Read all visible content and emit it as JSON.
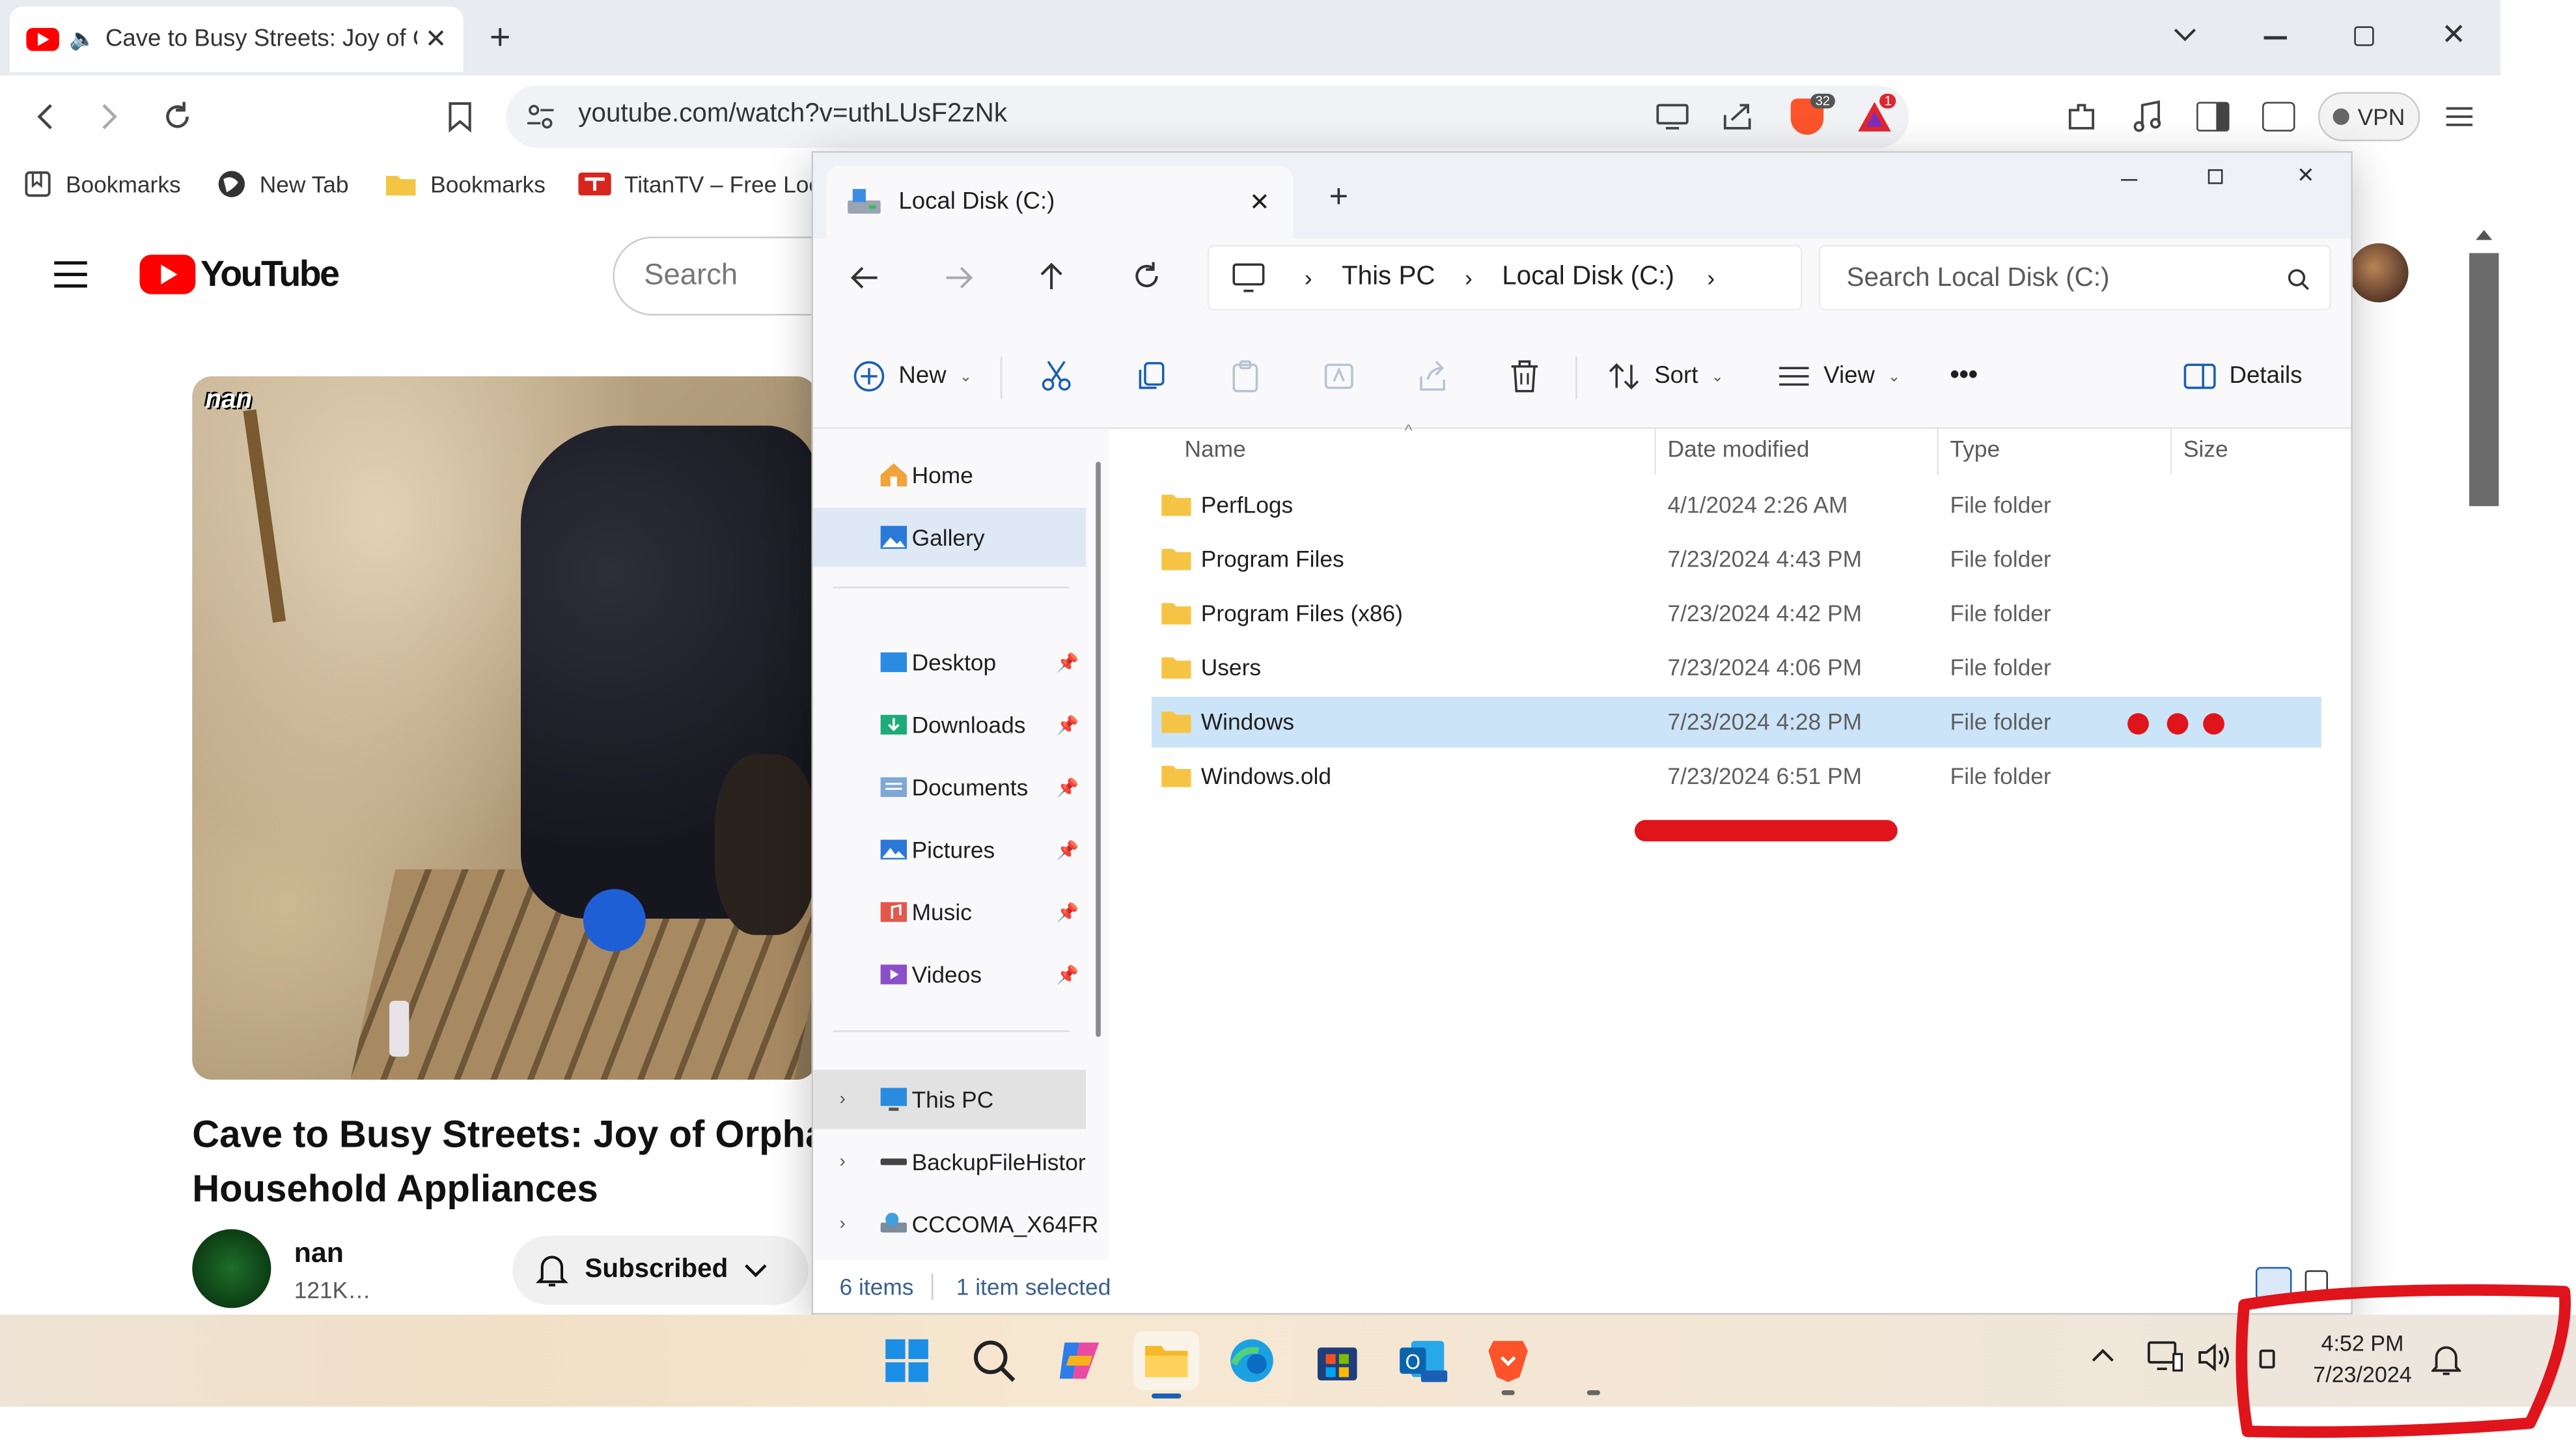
{
  "browser": {
    "tab_title": "Cave to Busy Streets: Joy of C",
    "url": "youtube.com/watch?v=uthLUsF2zNk",
    "shields_count": "32",
    "rewards_badge": "1",
    "vpn_label": "VPN",
    "bookmarks": [
      {
        "label": "Bookmarks",
        "icon": "bookmarks-icon"
      },
      {
        "label": "New Tab",
        "icon": "globe-icon"
      },
      {
        "label": "Bookmarks",
        "icon": "folder-icon"
      },
      {
        "label": "TitanTV – Free Loc",
        "icon": "titantv-icon"
      }
    ]
  },
  "youtube": {
    "logo_text": "YouTube",
    "search_placeholder": "Search",
    "watermark": "nan",
    "video_title_line1": "Cave to Busy Streets: Joy of Orphar",
    "video_title_line2": "Household Appliances",
    "channel_name": "nan",
    "subscribers": "121K…",
    "subscribed_label": "Subscribed"
  },
  "explorer": {
    "tab_title": "Local Disk (C:)",
    "breadcrumb": [
      "This PC",
      "Local Disk (C:)"
    ],
    "search_placeholder": "Search Local Disk (C:)",
    "commands": {
      "new": "New",
      "sort": "Sort",
      "view": "View",
      "more": "•••",
      "details": "Details"
    },
    "nav": {
      "quick": [
        {
          "label": "Home",
          "icon": "home-icon"
        },
        {
          "label": "Gallery",
          "icon": "gallery-icon"
        }
      ],
      "pinned": [
        {
          "label": "Desktop",
          "icon": "desktop-folder-icon"
        },
        {
          "label": "Downloads",
          "icon": "downloads-folder-icon"
        },
        {
          "label": "Documents",
          "icon": "documents-folder-icon"
        },
        {
          "label": "Pictures",
          "icon": "pictures-folder-icon"
        },
        {
          "label": "Music",
          "icon": "music-folder-icon"
        },
        {
          "label": "Videos",
          "icon": "videos-folder-icon"
        }
      ],
      "drives": [
        {
          "label": "This PC",
          "icon": "pc-icon"
        },
        {
          "label": "BackupFileHistor",
          "icon": "drive-icon"
        },
        {
          "label": "CCCOMA_X64FR",
          "icon": "dvd-drive-icon"
        }
      ]
    },
    "columns": {
      "name": "Name",
      "date": "Date modified",
      "type": "Type",
      "size": "Size"
    },
    "files": [
      {
        "name": "PerfLogs",
        "date": "4/1/2024 2:26 AM",
        "type": "File folder"
      },
      {
        "name": "Program Files",
        "date": "7/23/2024 4:43 PM",
        "type": "File folder"
      },
      {
        "name": "Program Files (x86)",
        "date": "7/23/2024 4:42 PM",
        "type": "File folder"
      },
      {
        "name": "Users",
        "date": "7/23/2024 4:06 PM",
        "type": "File folder"
      },
      {
        "name": "Windows",
        "date": "7/23/2024 4:28 PM",
        "type": "File folder"
      },
      {
        "name": "Windows.old",
        "date": "7/23/2024 6:51 PM",
        "type": "File folder"
      }
    ],
    "status": {
      "items": "6 items",
      "selected": "1 item selected"
    }
  },
  "taskbar": {
    "time": "4:52 PM",
    "date": "7/23/2024",
    "icons": [
      "start-icon",
      "search-icon",
      "copilot-icon",
      "file-explorer-icon",
      "edge-icon",
      "store-icon",
      "outlook-icon",
      "brave-icon"
    ]
  },
  "colors": {
    "annotation_red": "#e0141b",
    "selection": "#cce4f7",
    "youtube_red": "#ff0000"
  }
}
